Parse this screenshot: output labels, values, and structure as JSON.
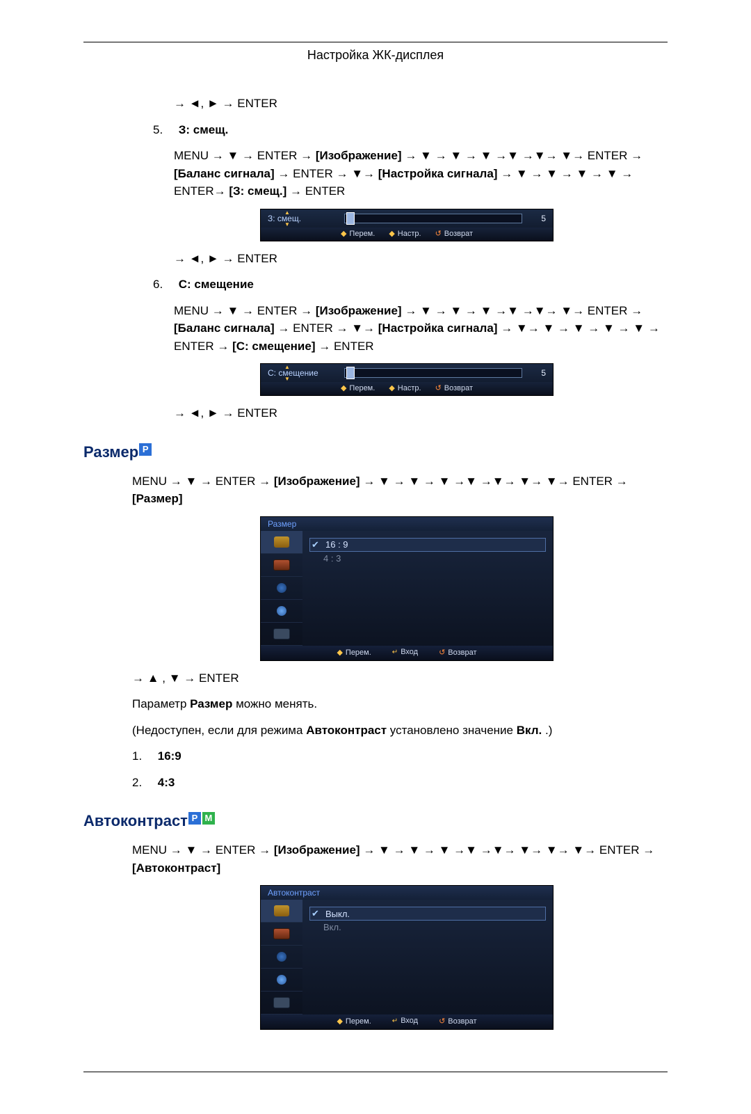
{
  "header": {
    "title": "Настройка ЖК-дисплея"
  },
  "footer_present": true,
  "nav_tokens": {
    "enter": "ENTER",
    "menu": "MENU",
    "image_label": "Изображение",
    "balance_label": "Баланс сигнала",
    "tuning_label": "Настройка сигнала"
  },
  "step5": {
    "prenav": "→ ◄, ► → ENTER",
    "number": "5.",
    "title": "З: смещ.",
    "path_prefix": "MENU → ▼ → ENTER → ",
    "img": "[Изображение]",
    "path_mid1": " → ▼ → ▼ → ▼ →▼ →▼→ ▼→ ENTER → ",
    "bal": "[Баланс сигнала]",
    "path_mid2": "→ ENTER → ▼→ ",
    "tune": "[Настройка сигнала]",
    "path_mid3": " → ▼ → ▼ → ▼ → ▼ → ENTER→ ",
    "target": "[З: смещ.]",
    "path_end": " → ENTER",
    "slider_label": "З: смещ.",
    "slider_value": "5",
    "foot_move": "Перем.",
    "foot_adjust": "Настр.",
    "foot_back": "Возврат",
    "postnav": "→ ◄, ► → ENTER"
  },
  "step6": {
    "number": "6.",
    "title": "С: смещение",
    "path_prefix": "MENU → ▼ → ENTER → ",
    "img": "[Изображение]",
    "path_mid1": " → ▼ → ▼ → ▼ →▼ →▼→ ▼→ ENTER → ",
    "bal": "[Баланс сигнала]",
    "path_mid2": "→ ENTER → ▼→ ",
    "tune": "[Настройка сигнала]",
    "path_mid3": " → ▼→ ▼ → ▼ → ▼ → ▼ → ENTER → ",
    "target": "[С: смещение]",
    "path_end": " → ENTER",
    "slider_label": "С: смещение",
    "slider_value": "5",
    "foot_move": "Перем.",
    "foot_adjust": "Настр.",
    "foot_back": "Возврат",
    "postnav": "→ ◄, ► → ENTER"
  },
  "size_section": {
    "heading": "Размер",
    "badge": "P",
    "path_prefix": "MENU → ▼ → ENTER → ",
    "img": "[Изображение]",
    "path_mid": " → ▼ → ▼ → ▼ →▼ →▼→ ▼→ ▼→ ENTER → ",
    "target": "[Размер]",
    "menu_title": "Размер",
    "options": [
      "16 : 9",
      "4 : 3"
    ],
    "foot_move": "Перем.",
    "foot_enter": "Вход",
    "foot_back": "Возврат",
    "postnav": "→ ▲ , ▼ → ENTER",
    "para1_prefix": "Параметр ",
    "para1_bold": "Размер",
    "para1_suffix": " можно менять.",
    "para2_prefix": "(Недоступен, если для режима ",
    "para2_b1": "Автоконтраст",
    "para2_mid": " установлено значение ",
    "para2_b2": "Вкл.",
    "para2_suffix": ".)",
    "list1_num": "1.",
    "list1_val": "16:9",
    "list2_num": "2.",
    "list2_val": "4:3"
  },
  "auto_section": {
    "heading": "Автоконтраст",
    "badge_p": "P",
    "badge_m": "M",
    "path_prefix": "MENU → ▼ → ENTER → ",
    "img": "[Изображение]",
    "path_mid": " → ▼ → ▼ → ▼ →▼ →▼→ ▼→ ▼→ ▼→ ENTER → ",
    "target": "[Автоконтраст]",
    "menu_title": "Автоконтраст",
    "options": [
      "Выкл.",
      "Вкл."
    ],
    "foot_move": "Перем.",
    "foot_enter": "Вход",
    "foot_back": "Возврат"
  }
}
